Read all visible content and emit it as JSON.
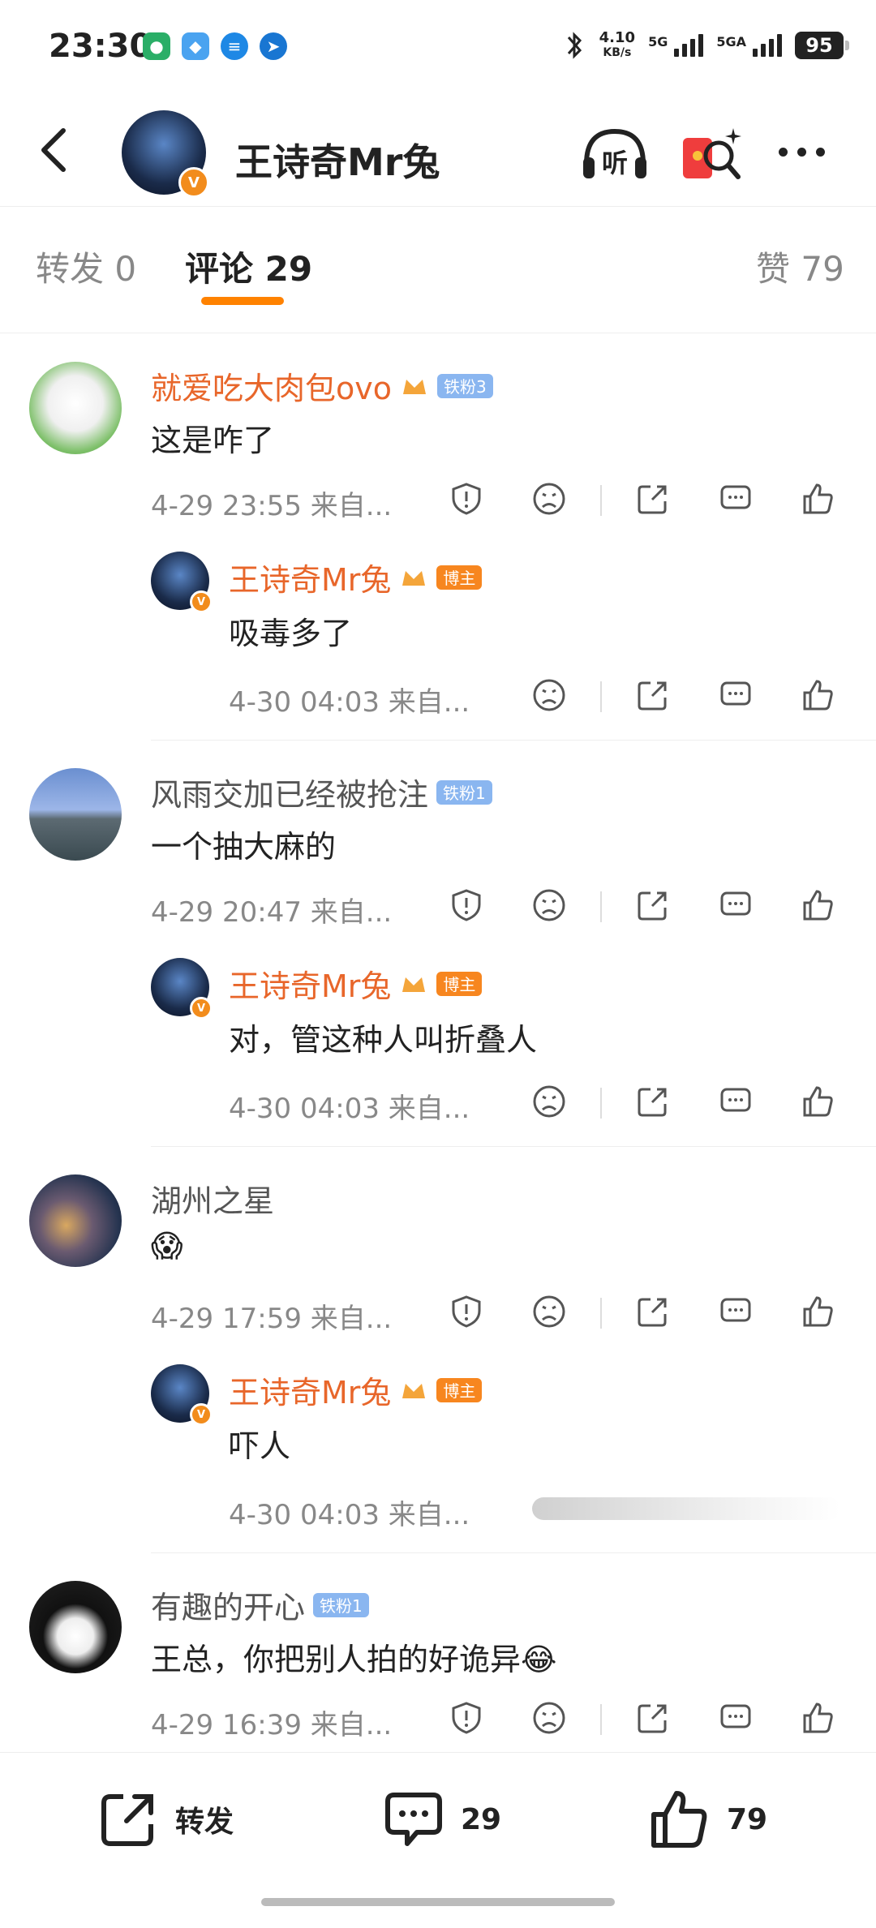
{
  "status": {
    "time": "23:30",
    "speed_top": "4.10",
    "speed_unit": "KB/s",
    "net1": "5G",
    "net2": "5GA",
    "battery": "95"
  },
  "header": {
    "title": "王诗奇Mr兔",
    "listen_label": "听"
  },
  "tabs": {
    "forward": "转发",
    "forward_count": "0",
    "comments": "评论",
    "comments_count": "29",
    "likes": "赞",
    "likes_count": "79"
  },
  "comments": [
    {
      "name": "就爱吃大肉包ovo",
      "badge": "铁粉3",
      "text": "这是咋了",
      "meta": "4-29 23:55  来自...",
      "reply": {
        "name": "王诗奇Mr兔",
        "badge": "博主",
        "text": "吸毒多了",
        "meta": "4-30 04:03  来自..."
      }
    },
    {
      "name": "风雨交加已经被抢注",
      "badge": "铁粉1",
      "text": "一个抽大麻的",
      "meta": "4-29 20:47  来自...",
      "reply": {
        "name": "王诗奇Mr兔",
        "badge": "博主",
        "text": "对，管这种人叫折叠人",
        "meta": "4-30 04:03  来自..."
      }
    },
    {
      "name": "湖州之星",
      "badge": "",
      "text": "😱",
      "meta": "4-29 17:59  来自...",
      "reply": {
        "name": "王诗奇Mr兔",
        "badge": "博主",
        "text": "吓人",
        "meta": "4-30 04:03  来自..."
      }
    },
    {
      "name": "有趣的开心",
      "badge": "铁粉1",
      "text": "王总，你把别人拍的好诡异😂",
      "meta": "4-29 16:39  来自..."
    }
  ],
  "bottom": {
    "forward": "转发",
    "comments": "29",
    "likes": "79"
  },
  "colors": {
    "accent": "#ff8200",
    "username_orange": "#e8662a",
    "fan_badge": "#8ab6f0",
    "host_badge": "#f7861f"
  }
}
